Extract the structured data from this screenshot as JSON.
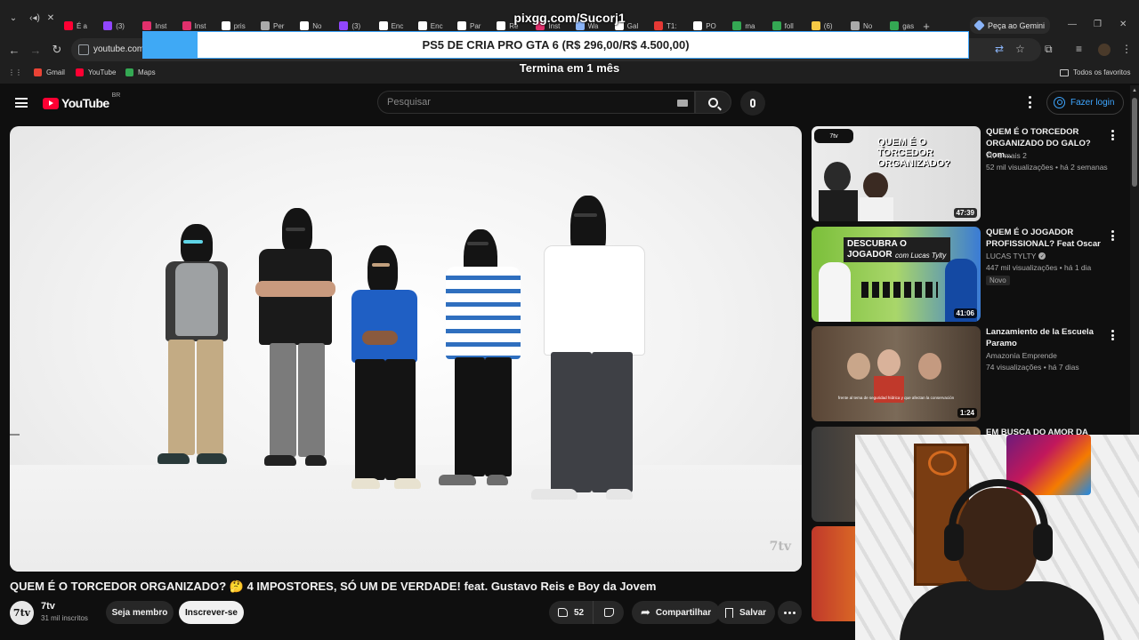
{
  "browser": {
    "tabs": [
      {
        "label": "É a",
        "color": "#ff0033"
      },
      {
        "label": "(3)",
        "color": "#9146ff"
      },
      {
        "label": "Inst",
        "color": "#e1306c"
      },
      {
        "label": "Inst",
        "color": "#e1306c"
      },
      {
        "label": "pris",
        "color": "#ffffff"
      },
      {
        "label": "Per",
        "color": "#aaaaaa"
      },
      {
        "label": "No",
        "color": "#ffffff"
      },
      {
        "label": "(3)",
        "color": "#9146ff"
      },
      {
        "label": "Enc",
        "color": "#ffffff"
      },
      {
        "label": "Enc",
        "color": "#ffffff"
      },
      {
        "label": "Par",
        "color": "#ffffff"
      },
      {
        "label": "Re",
        "color": "#ffffff"
      },
      {
        "label": "Inst",
        "color": "#e1306c"
      },
      {
        "label": "Wa",
        "color": "#8ab4f8"
      },
      {
        "label": "Gal",
        "color": "#ffffff"
      },
      {
        "label": "T1:",
        "color": "#e53935"
      },
      {
        "label": "PO",
        "color": "#ffffff"
      },
      {
        "label": "ma",
        "color": "#34a853"
      },
      {
        "label": "foll",
        "color": "#34a853"
      },
      {
        "label": "(6)",
        "color": "#f6c945"
      },
      {
        "label": "No",
        "color": "#aaaaaa"
      },
      {
        "label": "gas",
        "color": "#34a853"
      }
    ],
    "gemini_label": "Peça ao Gemini",
    "url": "youtube.com/",
    "bookmarks": [
      {
        "label": "Gmail",
        "color": "#ea4335"
      },
      {
        "label": "YouTube",
        "color": "#ff0033"
      },
      {
        "label": "Maps",
        "color": "#34a853"
      }
    ],
    "favorites_label": "Todos os favoritos"
  },
  "overlay": {
    "handle": "pixgg.com/Sucorj1",
    "goal_text": "PS5 DE CRIA PRO GTA 6 (R$ 296,00/R$ 4.500,00)",
    "goal_progress": 0.066,
    "goal_fill_color": "#3fa9f5",
    "goal_ends": "Termina em 1 mês"
  },
  "youtube": {
    "logo_text": "YouTube",
    "country_code": "BR",
    "search_placeholder": "Pesquisar",
    "login_label": "Fazer login",
    "brand_color": "#ff0033",
    "accent_color": "#3ea6ff"
  },
  "video": {
    "title": "QUEM É O TORCEDOR ORGANIZADO? 🤔 4 IMPOSTORES, SÓ UM DE VERDADE! feat. Gustavo Reis e Boy da Jovem",
    "watermark": "7tv",
    "channel": {
      "avatar_text": "7tv",
      "name": "7tv",
      "subscribers": "31 mil inscritos"
    },
    "member_label": "Seja membro",
    "subscribe_label": "Inscrever-se",
    "likes": "52",
    "share_label": "Compartilhar",
    "save_label": "Salvar"
  },
  "recommendations": [
    {
      "title": "QUEM É O TORCEDOR ORGANIZADO DO GALO? Com...",
      "channel": "7tv e mais 2",
      "meta": "52 mil visualizações • há 2 semanas",
      "duration": "47:39",
      "thumb_text": "QUEM É O TORCEDOR ORGANIZADO?"
    },
    {
      "title": "QUEM É O JOGADOR PROFISSIONAL? Feat Oscar",
      "channel": "LUCAS TYLTY",
      "verified": true,
      "meta": "447 mil visualizações • há 1 dia",
      "badge": "Novo",
      "duration": "41:06",
      "thumb_text": "DESCUBRA O JOGADOR",
      "thumb_sub": "com Lucas Tylty"
    },
    {
      "title": "Lanzamiento de la Escuela Paramo",
      "channel": "Amazonía Emprende",
      "meta": "74 visualizações • há 7 dias",
      "duration": "1:24",
      "thumb_text": "frente al tema de seguridad hídrica y que afectan la conservación"
    },
    {
      "title": "EM BUSCA DO AMOR DA"
    }
  ]
}
